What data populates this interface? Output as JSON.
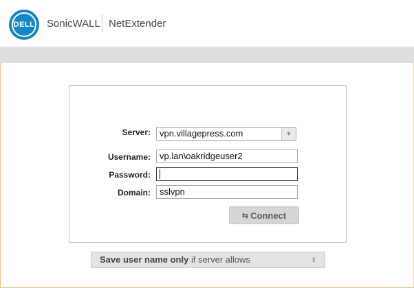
{
  "header": {
    "logo_text": "DELL",
    "brand": "SonicWALL",
    "product": "NetExtender"
  },
  "form": {
    "server_label": "Server:",
    "server_value": "vpn.villagepress.com",
    "username_label": "Username:",
    "username_value": "vp.lan\\oakridgeuser2",
    "password_label": "Password:",
    "password_value": "",
    "domain_label": "Domain:",
    "domain_value": "sslvpn",
    "connect_label": "Connect"
  },
  "save_option": {
    "bold_text": "Save user name only",
    "rest_text": " if server allows"
  },
  "icons": {
    "connect": "swap-arrows-icon",
    "dropdown": "chevron-down-icon"
  },
  "colors": {
    "brand_blue": "#1386c7",
    "band_gray": "#dedede"
  }
}
